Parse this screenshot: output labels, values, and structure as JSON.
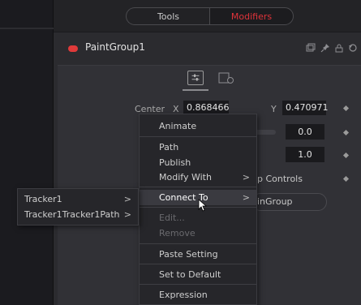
{
  "tabs": {
    "tools": "Tools",
    "modifiers": "Modifiers"
  },
  "node": {
    "title": "PaintGroup1",
    "accent": "#e03a3a"
  },
  "center": {
    "label": "Center",
    "x_label": "X",
    "x_value": "0.868466",
    "y_label": "Y",
    "y_value": "0.470971"
  },
  "fields": {
    "value_1": "0.0",
    "value_2": "1.0"
  },
  "partial": {
    "controls_text": "p Controls",
    "group_button": "inGroup"
  },
  "context_menu": {
    "items": [
      {
        "label": "Animate"
      },
      {
        "label": "Path"
      },
      {
        "label": "Publish"
      },
      {
        "label": "Modify With",
        "arrow": ">"
      },
      {
        "label": "Connect To",
        "arrow": ">"
      },
      {
        "label": "Edit..."
      },
      {
        "label": "Remove"
      },
      {
        "label": "Paste Setting"
      },
      {
        "label": "Set to Default"
      },
      {
        "label": "Expression"
      }
    ]
  },
  "submenu": {
    "items": [
      {
        "label": "Tracker1",
        "arrow": ">"
      },
      {
        "label": "Tracker1Tracker1Path",
        "arrow": ">"
      }
    ]
  },
  "icons": {
    "header": [
      "copy-icon",
      "pin-icon",
      "lock-icon",
      "reset-icon"
    ],
    "cursor": "pointer-cursor-icon"
  }
}
